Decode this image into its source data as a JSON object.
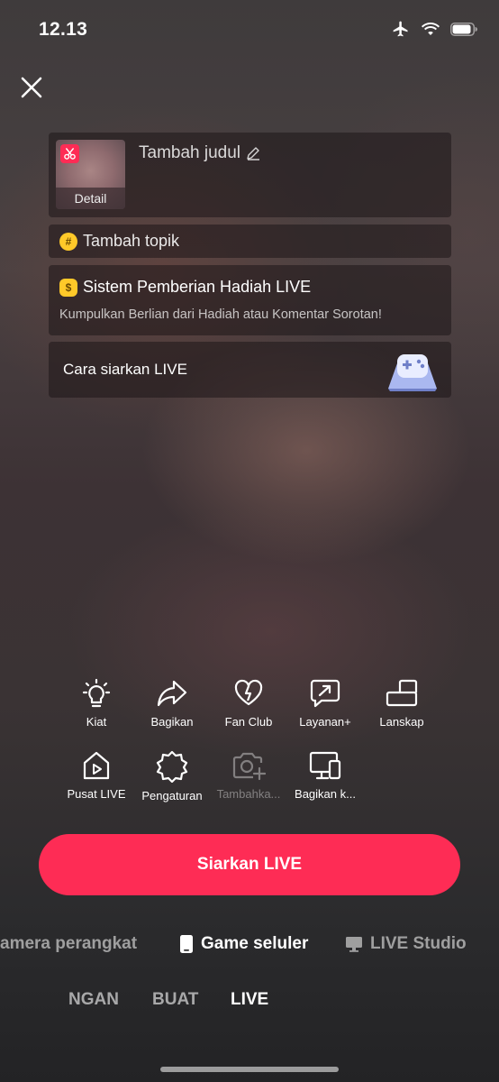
{
  "status_bar": {
    "time": "12.13",
    "icons": [
      "airplane-icon",
      "wifi-icon",
      "battery-icon"
    ]
  },
  "close": {
    "icon": "close-icon"
  },
  "title_card": {
    "thumbnail_label": "Detail",
    "title_placeholder": "Tambah judul",
    "edit_icon": "pencil-icon"
  },
  "topic_card": {
    "label": "Tambah topik",
    "icon": "hashtag-icon"
  },
  "gift_card": {
    "title": "Sistem Pemberian Hadiah LIVE",
    "subtitle": "Kumpulkan Berlian dari Hadiah atau Komentar Sorotan!",
    "icon": "money-bag-icon"
  },
  "how_card": {
    "label": "Cara siarkan LIVE",
    "icon": "game-controller-icon"
  },
  "tools": [
    {
      "label": "Kiat",
      "icon": "lightbulb-icon"
    },
    {
      "label": "Bagikan",
      "icon": "share-icon"
    },
    {
      "label": "Fan Club",
      "icon": "heart-icon"
    },
    {
      "label": "Layanan+",
      "icon": "chat-arrow-icon"
    },
    {
      "label": "Lanskap",
      "icon": "landscape-icon"
    },
    {
      "label": "Pusat LIVE",
      "icon": "live-center-icon"
    },
    {
      "label": "Pengaturan",
      "icon": "gear-icon"
    },
    {
      "label": "Tambahka...",
      "icon": "camera-add-icon",
      "disabled": true
    },
    {
      "label": "Bagikan k...",
      "icon": "share-screen-icon"
    }
  ],
  "primary_action": {
    "label": "Siarkan LIVE",
    "color": "#fe2c55"
  },
  "modes": [
    {
      "label": "amera perangkat",
      "active": false
    },
    {
      "label": "Game seluler",
      "icon": "phone-icon",
      "active": true
    },
    {
      "label": "LIVE Studio",
      "icon": "monitor-icon",
      "active": false
    }
  ],
  "tabs": [
    {
      "label": "NGAN",
      "active": false
    },
    {
      "label": "BUAT",
      "active": false
    },
    {
      "label": "LIVE",
      "active": true
    }
  ]
}
